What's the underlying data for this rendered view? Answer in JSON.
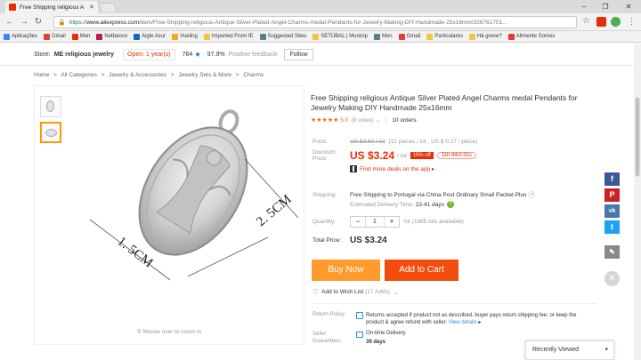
{
  "browser": {
    "tab_title": "Free Shipping religious A",
    "url_scheme": "https://",
    "url_host": "www.aliexpress.com",
    "url_path": "/item/Free-Shipping-religious-Antique-Silver-Plated-Angel-Charms-medal-Pendants-for-Jewelry-Making-DIY-Handmade-25x16mm/326761701..."
  },
  "bookmarks": [
    {
      "label": "Aplicações",
      "color": "#4285f4"
    },
    {
      "label": "Gmail",
      "color": "#db4437"
    },
    {
      "label": "Mon",
      "color": "#e62e04"
    },
    {
      "label": "Netbanco",
      "color": "#c2185b"
    },
    {
      "label": "Aigle Azur",
      "color": "#1565c0"
    },
    {
      "label": "Vueling",
      "color": "#f9a825"
    },
    {
      "label": "Imported From IE",
      "color": "#f4c542"
    },
    {
      "label": "Suggested Sites",
      "color": "#607d8b"
    },
    {
      "label": "SETÚBAL | Municip",
      "color": "#f4c542"
    },
    {
      "label": "Mon",
      "color": "#607d8b"
    },
    {
      "label": "Gmail",
      "color": "#db4437"
    },
    {
      "label": "Particulares",
      "color": "#f4c542"
    },
    {
      "label": "Há greve?",
      "color": "#f4c542"
    },
    {
      "label": "Alimente Somos",
      "color": "#e53935"
    }
  ],
  "store": {
    "label": "Store:",
    "name": "ME religious jewelry",
    "open": "Open: 1 year(s)",
    "score": "764",
    "positive_pct": "97.9%",
    "feedback": "Positive feedback",
    "follow": "Follow"
  },
  "breadcrumb": [
    "Home",
    ">",
    "All Categories",
    ">",
    "Jewelry & Accessories",
    ">",
    "Jewelry Sets & More",
    ">",
    "Charms"
  ],
  "gallery": {
    "zoom_hint": "Mouse over to zoom in",
    "dim_long": "2. 5CM",
    "dim_short": "1. 5CM"
  },
  "product": {
    "title": "Free Shipping religious Antique Silver Plated Angel Charms medal Pendants for Jewelry Making DIY Handmade 25x16mm",
    "stars": "★★★★★",
    "rating": "5.0",
    "votes": "(9 votes)",
    "orders": "10 orders",
    "price_label": "Price:",
    "original_price": "US $3.60 / lot",
    "pieces_note": "(12 pieces / lot , US $ 0.27 / piece)",
    "discount_label_1": "Discount",
    "discount_label_2": "Price:",
    "discount_price": "US $3.24",
    "per_lot": "/ lot",
    "off": "10% off",
    "timer": "11h:44m:31s",
    "deals": "Find more deals on the app",
    "shipping_label": "Shipping:",
    "shipping_text": "Free Shipping to Portugal via China Post Ordinary Small Packet Plus",
    "est_label": "Estimated Delivery Time:",
    "est_days": "22-41 days",
    "qty_label": "Quantity:",
    "qty_minus": "−",
    "qty_value": "1",
    "qty_plus": "+",
    "lots_available": "lot (1985 lots available)",
    "total_label": "Total Price:",
    "total_value": "US $3.24",
    "buy_now": "Buy Now",
    "add_to_cart": "Add to Cart",
    "wish": "Add to Wish List",
    "wish_adds": "(17 Adds)",
    "return_label": "Return Policy:",
    "return_text": "Returns accepted if product not as described, buyer pays return shipping fee; or keep the product & agree refund with seller.",
    "view_details": "View details",
    "seller_label_1": "Seller",
    "seller_label_2": "Guarantees:",
    "on_time": "On-time Delivery",
    "guar_days": "39 days"
  },
  "recently_viewed": "Recently Viewed",
  "accent": "#e62e04"
}
